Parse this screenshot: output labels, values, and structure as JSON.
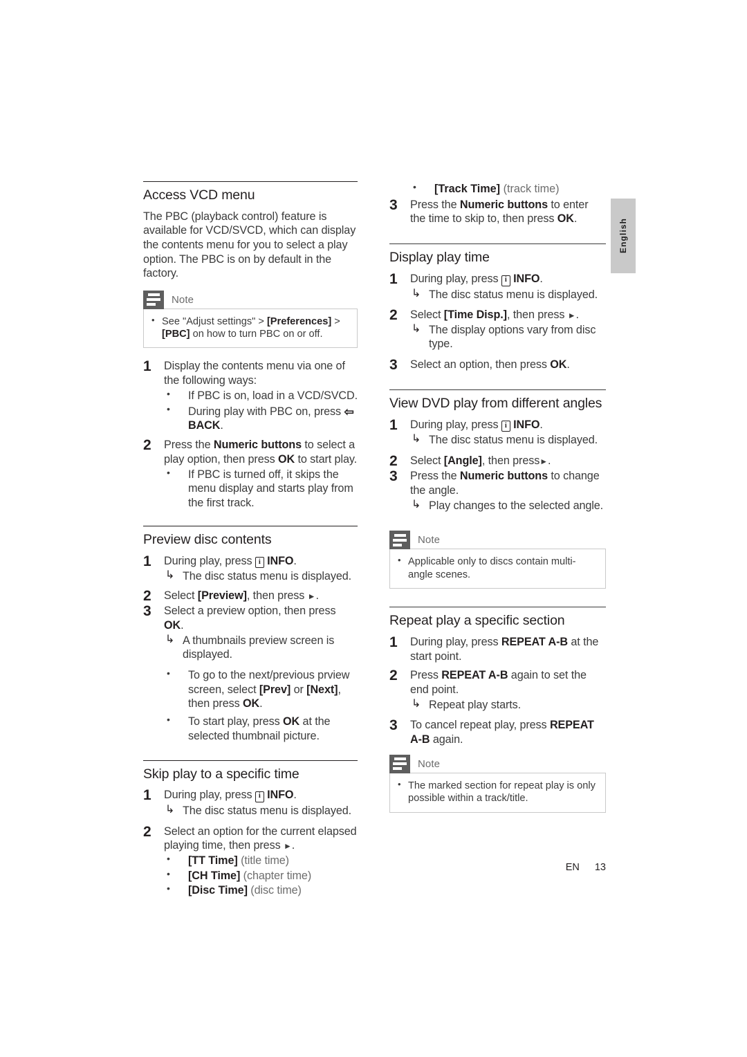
{
  "language_tab": {
    "label": "English"
  },
  "footer": {
    "lang_code": "EN",
    "page_number": "13"
  },
  "icons": {
    "note": "note-icon",
    "info": "info-icon",
    "back": "back-arrow-icon",
    "result_arrow": "↳",
    "bullet": "•",
    "right_triangle": "►"
  },
  "left_column": {
    "sections": [
      {
        "title": "Access VCD menu",
        "intro": "The PBC (playback control) feature is available for VCD/SVCD, which can display the contents menu for you to select a play option. The PBC is on by default in the factory.",
        "note": {
          "label": "Note",
          "items": [
            "See \"Adjust settings\" > [Preferences] > [PBC] on how to turn PBC on or off."
          ]
        },
        "steps": [
          {
            "num": "1",
            "text": "Display the contents menu via one of the following ways:",
            "bullets": [
              "If PBC is on, load in a VCD/SVCD.",
              "During play with PBC on, press ↰ BACK."
            ]
          },
          {
            "num": "2",
            "text": "Press the Numeric buttons to select a play option, then press OK to start play.",
            "bullets": [
              "If PBC is turned off, it skips the menu display and starts play from the first track."
            ]
          }
        ]
      },
      {
        "title": "Preview disc contents",
        "steps": [
          {
            "num": "1",
            "text": "During play, press ⓘ INFO.",
            "result": "The disc status menu is displayed."
          },
          {
            "num": "2",
            "text": "Select [Preview], then press ►."
          },
          {
            "num": "3",
            "text": "Select a preview option, then press OK.",
            "result": "A thumbnails preview screen is displayed.",
            "bullets": [
              "To go to the next/previous prview screen, select [Prev] or [Next], then press OK.",
              "To start play, press OK at the selected thumbnail picture."
            ]
          }
        ]
      },
      {
        "title": "Skip play to a specific time",
        "steps": [
          {
            "num": "1",
            "text": "During play, press ⓘ INFO.",
            "result": "The disc status menu is displayed."
          },
          {
            "num": "2",
            "text": "Select an option for the current elapsed playing time, then press ►.",
            "bullets": [
              "[TT Time] (title time)",
              "[CH Time] (chapter time)",
              "[Disc Time] (disc time)"
            ]
          }
        ]
      }
    ]
  },
  "right_column": {
    "continued": {
      "bullet": "[Track Time] (track time)",
      "step": {
        "num": "3",
        "text": "Press the Numeric buttons to enter the time to skip to, then press OK."
      }
    },
    "sections": [
      {
        "title": "Display play time",
        "steps": [
          {
            "num": "1",
            "text": "During play, press ⓘ INFO.",
            "result": "The disc status menu is displayed."
          },
          {
            "num": "2",
            "text": "Select [Time Disp.], then press ►.",
            "result": "The display options vary from disc type."
          },
          {
            "num": "3",
            "text": "Select an option, then press OK."
          }
        ]
      },
      {
        "title": "View DVD play from different angles",
        "steps": [
          {
            "num": "1",
            "text": "During play, press ⓘ INFO.",
            "result": "The disc status menu is displayed."
          },
          {
            "num": "2",
            "text": "Select [Angle], then press►."
          },
          {
            "num": "3",
            "text": "Press the Numeric buttons to change the angle.",
            "result": "Play changes to the selected angle."
          }
        ],
        "note": {
          "label": "Note",
          "items": [
            "Applicable only to discs contain multi-angle scenes."
          ]
        }
      },
      {
        "title": "Repeat play a specific section",
        "steps": [
          {
            "num": "1",
            "text": "During play, press REPEAT A-B at the start point."
          },
          {
            "num": "2",
            "text": "Press REPEAT A-B again to set the end point.",
            "result": "Repeat play starts."
          },
          {
            "num": "3",
            "text": "To cancel repeat play, press REPEAT A-B again."
          }
        ],
        "note": {
          "label": "Note",
          "items": [
            "The marked section for repeat play is only possible within a track/title."
          ]
        }
      }
    ]
  }
}
